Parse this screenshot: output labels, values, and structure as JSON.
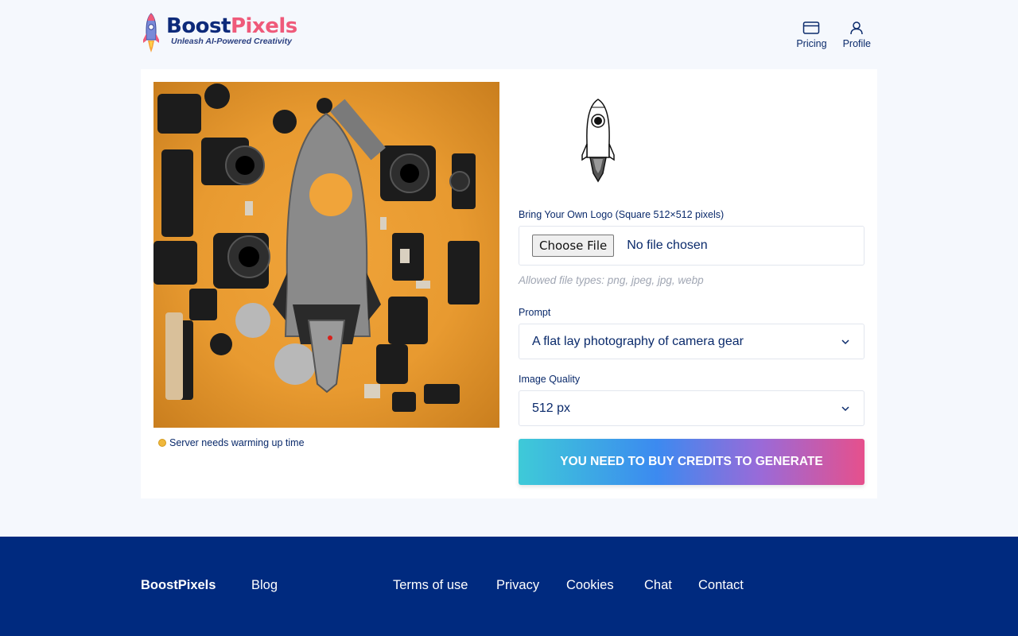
{
  "header": {
    "logo_name_part1": "Boost",
    "logo_name_part2": "Pixels",
    "logo_tagline": "Unleash AI-Powered Creativity",
    "nav": [
      {
        "label": "Pricing",
        "icon": "credit-card-icon"
      },
      {
        "label": "Profile",
        "icon": "user-icon"
      }
    ]
  },
  "preview": {
    "image_description": "camera-gear-flatlay-with-rocket",
    "status_text": "Server needs warming up time",
    "status_color": "#f0b83c"
  },
  "form": {
    "logo_label": "Bring Your Own Logo (Square 512×512 pixels)",
    "file_button": "Choose File",
    "file_status": "No file chosen",
    "file_hint": "Allowed file types: png, jpeg, jpg, webp",
    "prompt_label": "Prompt",
    "prompt_value": "A flat lay photography of camera gear",
    "quality_label": "Image Quality",
    "quality_value": "512 px",
    "cta_label": "YOU NEED TO BUY CREDITS TO GENERATE"
  },
  "footer": {
    "brand": "BoostPixels",
    "links": [
      "Blog",
      "Terms of use",
      "Privacy",
      "Cookies",
      "Chat",
      "Contact"
    ]
  },
  "colors": {
    "brand_navy": "#0d2a7a",
    "brand_pink": "#ef5a7a",
    "footer_bg": "#002a7f",
    "page_bg": "#f5f8fd"
  }
}
